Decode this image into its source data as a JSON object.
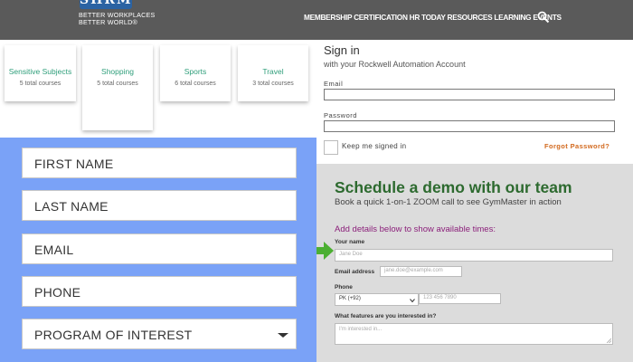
{
  "shrm": {
    "logo_text": "SHRM",
    "tagline_line1": "BETTER WORKPLACES",
    "tagline_line2": "BETTER WORLD®",
    "nav": "MEMBERSHIP CERTIFICATION HR TODAY RESOURCES LEARNING EVENTS",
    "search_icon": "search-icon"
  },
  "categories": [
    {
      "title": "Sensitive Subjects",
      "count": "5 total courses"
    },
    {
      "title": "Shopping",
      "count": "5 total courses"
    },
    {
      "title": "Sports",
      "count": "6 total courses"
    },
    {
      "title": "Travel",
      "count": "3 total courses"
    }
  ],
  "signin": {
    "title": "Sign in",
    "subtitle": "with your Rockwell Automation Account",
    "email_label": "Email",
    "password_label": "Password",
    "keep_label": "Keep me signed in",
    "forgot_label": "Forgot Password?"
  },
  "left_form": {
    "first_name": "FIRST NAME",
    "last_name": "LAST NAME",
    "email": "EMAIL",
    "phone": "PHONE",
    "program": "PROGRAM OF INTEREST"
  },
  "demo": {
    "title": "Schedule a demo with our team",
    "subtitle": "Book a quick 1-on-1 ZOOM call to see GymMaster in action",
    "add_details": "Add details below to show available times:",
    "name_label": "Your name",
    "name_placeholder": "Jane Doe",
    "email_label": "Email address",
    "email_placeholder": "jane.doe@example.com",
    "phone_label": "Phone",
    "phone_code": "PK (+92)",
    "phone_placeholder": "123 456 7890",
    "features_label": "What features are you interested in?",
    "features_placeholder": "I'm interested in..."
  },
  "colors": {
    "header_bg": "#5a5a5a",
    "logo_blue": "#2b63a3",
    "card_title_green": "#2e9e7a",
    "form_blue": "#7aa2f7",
    "forgot_orange": "#d2691e",
    "demo_green": "#2d6a2f",
    "demo_purple": "#8b1f7a",
    "arrow_green": "#4caf32"
  }
}
